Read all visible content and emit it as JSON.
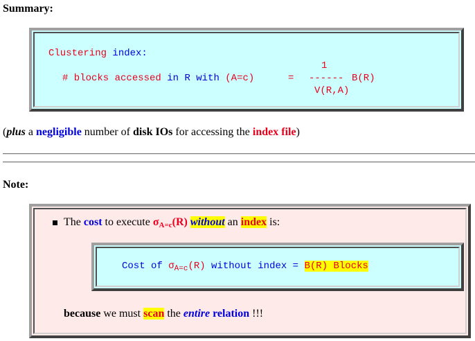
{
  "summary": {
    "heading": "Summary:",
    "formula": {
      "line1_a": "Clustering",
      "line1_b": "index:",
      "lhs_a": "# blocks accessed",
      "lhs_b": "in R with",
      "lhs_c": "(A=c)",
      "equals": "=",
      "numerator": "1",
      "fraction_bar": "------",
      "rhs": "B(R)",
      "denominator": "V(R,A)"
    },
    "note": {
      "p0": "(",
      "plus": "plus",
      "a": " a ",
      "negligible": "negligible",
      "number_of": " number of ",
      "disk_ios": "disk IOs",
      "for_accessing": " for accessing the ",
      "index_file": "index file",
      "p1": ")"
    }
  },
  "note_section": {
    "heading": "Note:",
    "bullet": {
      "the": "The ",
      "cost": "cost",
      "to_execute": " to execute ",
      "sigma": "σ",
      "sigma_sub": "A=c",
      "sigma_arg": "(R)",
      "without": "without",
      "an": " an ",
      "index": "index",
      "is": " is:"
    },
    "inner": {
      "cost_of": "Cost of ",
      "sigma": "σ",
      "sigma_sub": "A=c",
      "sigma_arg": "(R)",
      "without_index": " without index",
      "equals": " = ",
      "blocks": "B(R) Blocks"
    },
    "because": {
      "because": "because",
      "we_must": " we must ",
      "scan": "scan",
      "the": " the ",
      "entire": "entire",
      "relation": " relation",
      "bangs": " !!!"
    }
  },
  "colors": {
    "red": "#e8001c",
    "blue": "#0000dd",
    "cyan_box": "#ccffff",
    "pink_box": "#ffeaea",
    "highlight": "#ffff00"
  }
}
